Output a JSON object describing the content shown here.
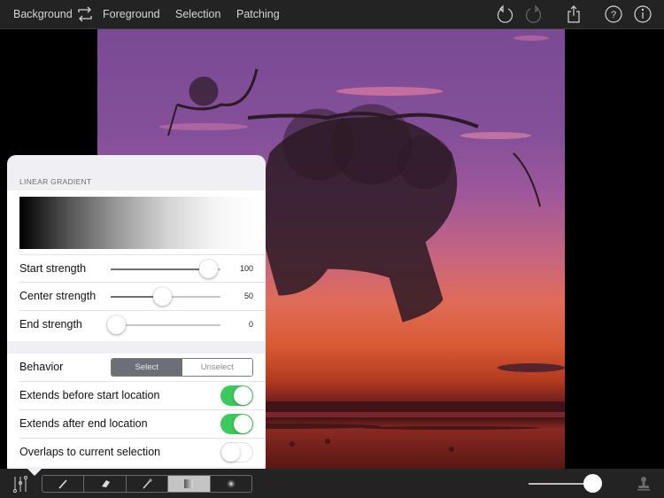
{
  "topbar": {
    "tabs": [
      {
        "label": "Background"
      },
      {
        "label": "Foreground"
      },
      {
        "label": "Selection"
      },
      {
        "label": "Patching"
      }
    ],
    "icons": {
      "swap": "swap-icon",
      "undo": "undo-icon",
      "redo": "redo-icon",
      "share": "share-icon",
      "help": "help-icon",
      "info": "info-icon"
    }
  },
  "popover": {
    "section_title": "LINEAR GRADIENT",
    "sliders": [
      {
        "label": "Start strength",
        "value": 100,
        "display": "100"
      },
      {
        "label": "Center strength",
        "value": 50,
        "display": "50"
      },
      {
        "label": "End strength",
        "value": 0,
        "display": "0"
      }
    ],
    "behavior": {
      "label": "Behavior",
      "options": [
        "Select",
        "Unselect"
      ],
      "selected": "Select"
    },
    "toggles": [
      {
        "label": "Extends before start location",
        "on": true
      },
      {
        "label": "Extends after end location",
        "on": true
      },
      {
        "label": "Overlaps to current selection",
        "on": false
      }
    ]
  },
  "bottombar": {
    "tools": [
      {
        "name": "brush",
        "icon": "brush-icon",
        "active": false
      },
      {
        "name": "eraser",
        "icon": "eraser-icon",
        "active": false
      },
      {
        "name": "magic-wand",
        "icon": "magic-wand-icon",
        "active": false
      },
      {
        "name": "linear-gradient",
        "icon": "linear-gradient-icon",
        "active": true
      },
      {
        "name": "radial-gradient",
        "icon": "radial-gradient-icon",
        "active": false
      }
    ],
    "zoom_value": 1.0
  },
  "colors": {
    "toggle_on": "#3dc95d",
    "bar_bg": "#232323",
    "segment_active": "#6e6e76"
  }
}
